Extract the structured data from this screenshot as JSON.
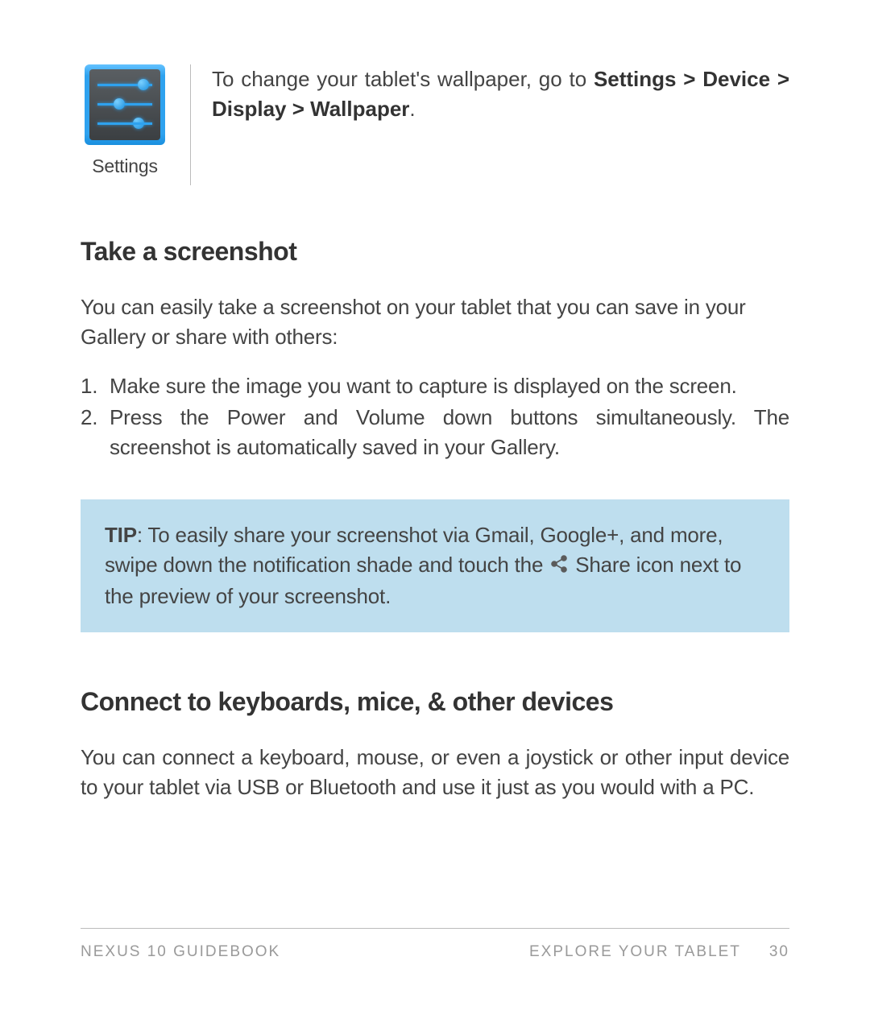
{
  "icon": {
    "caption": "Settings"
  },
  "wallpaper": {
    "pre": "To change your tablet's wallpaper, go to ",
    "bold": "Settings > Device > Display > Wallpaper",
    "post": "."
  },
  "screenshot": {
    "heading": "Take a screenshot",
    "intro": "You can easily take a screenshot on your tablet that you can save in your Gallery or share with others:",
    "steps": [
      "Make sure the image you want to capture is displayed on the screen.",
      "Press the Power and Volume down buttons simultaneously. The screenshot is automatically saved in your Gallery."
    ]
  },
  "tip": {
    "label": "TIP",
    "before": ": To easily share your screenshot via Gmail, Google+, and more, swipe down the notification shade and touch the ",
    "after": " Share icon next to the preview of your screenshot."
  },
  "connect": {
    "heading": "Connect to keyboards, mice, & other devices",
    "body": "You can connect a keyboard, mouse, or even a joystick or other input device to your tablet via USB or Bluetooth and use it just as you would with a PC."
  },
  "footer": {
    "left": "NEXUS 10 GUIDEBOOK",
    "section": "EXPLORE YOUR TABLET",
    "page": "30"
  }
}
